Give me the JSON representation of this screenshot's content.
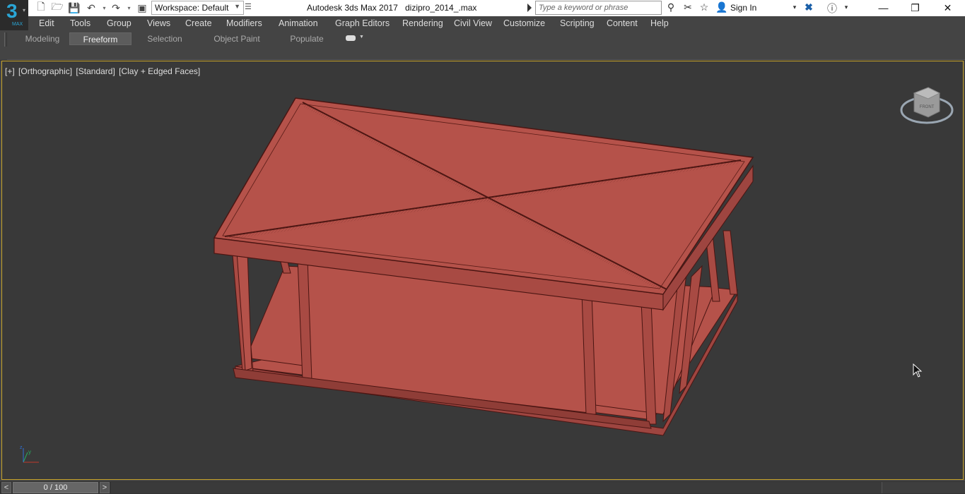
{
  "app": {
    "logo_number": "3",
    "logo_sub": "MAX",
    "title": "Autodesk 3ds Max 2017",
    "file": "dizipro_2014_.max"
  },
  "quick_access": {
    "workspace_label": "Workspace: Default"
  },
  "search": {
    "placeholder": "Type a keyword or phrase"
  },
  "account": {
    "sign_in": "Sign In"
  },
  "menu": {
    "items": [
      "Edit",
      "Tools",
      "Group",
      "Views",
      "Create",
      "Modifiers",
      "Animation",
      "Graph Editors",
      "Rendering",
      "Civil View",
      "Customize",
      "Scripting",
      "Content",
      "Help"
    ]
  },
  "ribbon": {
    "tabs": [
      "Modeling",
      "Freeform",
      "Selection",
      "Object Paint",
      "Populate"
    ],
    "active_tab": "Freeform"
  },
  "viewport": {
    "label_plus": "[+]",
    "label_view": "[Orthographic]",
    "label_style": "[Standard]",
    "label_shading": "[Clay + Edged Faces]",
    "viewcube_face": "FRONT",
    "axis_y": "y",
    "axis_z": "z",
    "object_color": "#b5524a",
    "background_color": "#393939",
    "border_color": "#c8a42a"
  },
  "timeline": {
    "frame_display": "0 / 100",
    "prev": "<",
    "next": ">"
  }
}
